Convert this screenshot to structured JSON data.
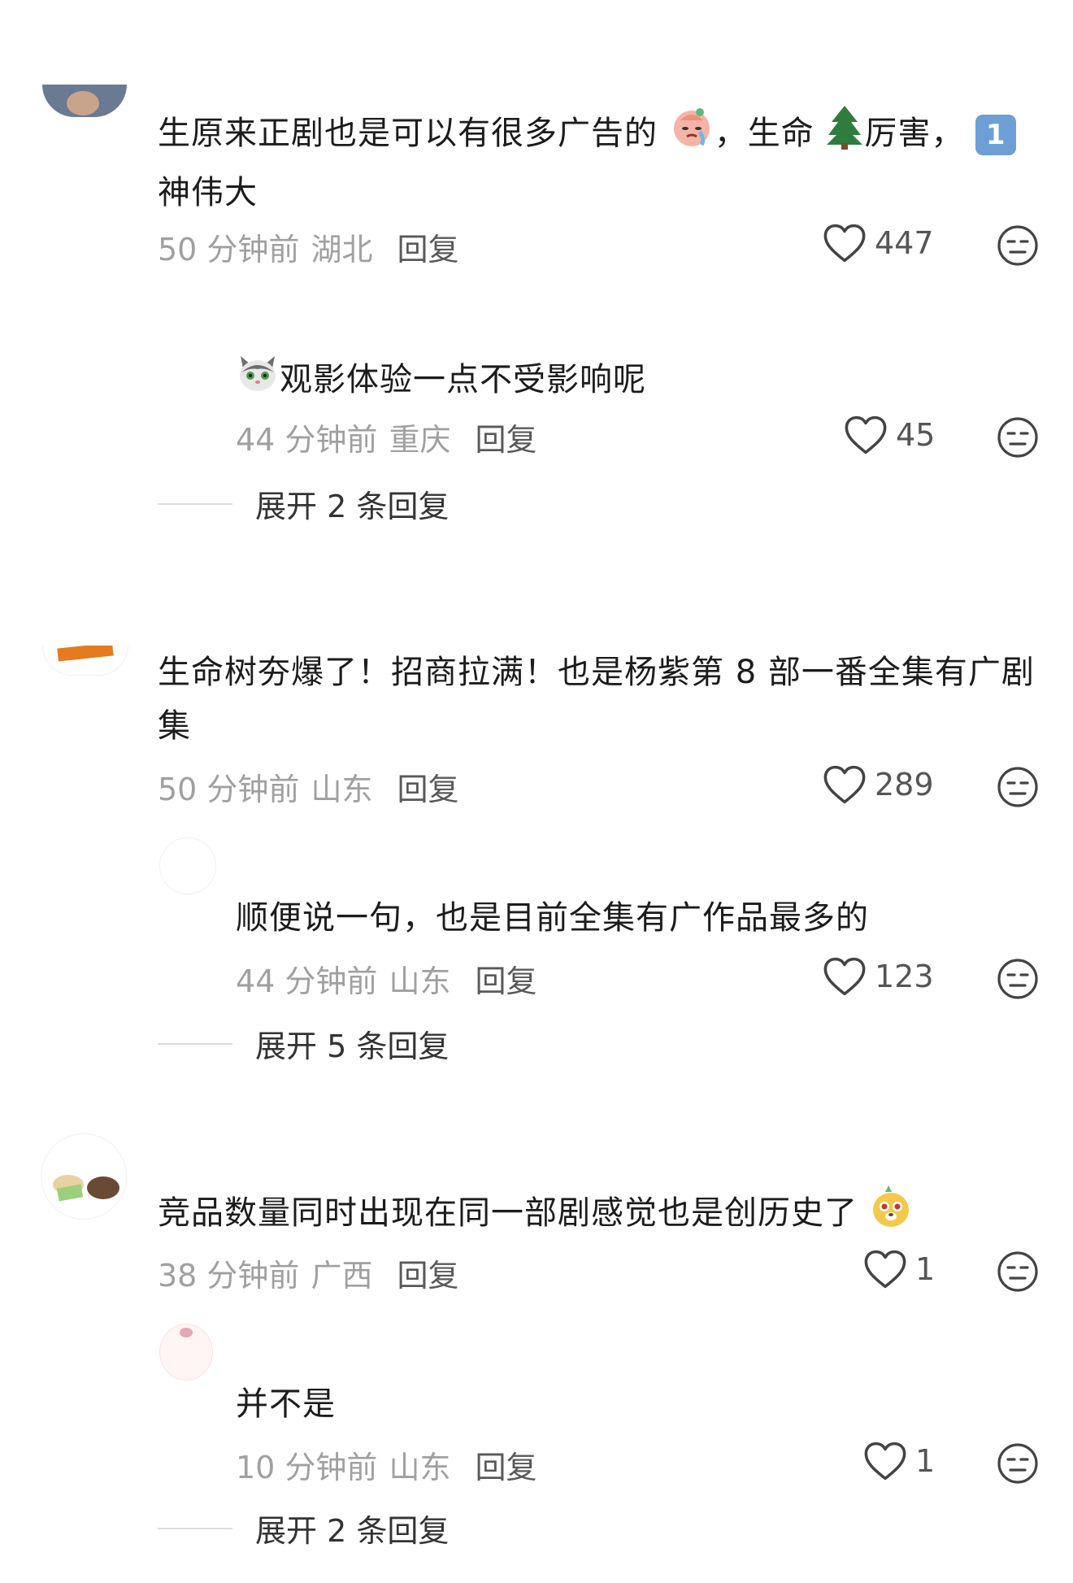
{
  "comments": [
    {
      "text_parts": [
        "生原来正剧也是可以有很多广告的",
        "，生命",
        "厉害，",
        "神伟大"
      ],
      "badge": "1",
      "time": "50 分钟前",
      "location": "湖北",
      "reply_label": "回复",
      "likes": "447",
      "expand_label": null
    },
    {
      "text": "观影体验一点不受影响呢",
      "time": "44 分钟前",
      "location": "重庆",
      "reply_label": "回复",
      "likes": "45",
      "expand_label": "展开 2 条回复"
    },
    {
      "text": "生命树夯爆了！招商拉满！也是杨紫第 8 部一番全集有广剧集",
      "time": "50 分钟前",
      "location": "山东",
      "reply_label": "回复",
      "likes": "289"
    },
    {
      "text": "顺便说一句，也是目前全集有广作品最多的",
      "time": "44 分钟前",
      "location": "山东",
      "reply_label": "回复",
      "likes": "123",
      "expand_label": "展开 5 条回复"
    },
    {
      "text": "竞品数量同时出现在同一部剧感觉也是创历史了",
      "time": "38 分钟前",
      "location": "广西",
      "reply_label": "回复",
      "likes": "1"
    },
    {
      "text": "并不是",
      "time": "10 分钟前",
      "location": "山东",
      "reply_label": "回复",
      "likes": "1",
      "expand_label": "展开 2 条回复"
    }
  ],
  "icons": {
    "like": "heart-outline-icon",
    "dislike": "neutral-face-icon",
    "tree": "evergreen-tree-emoji",
    "crying": "crying-face-emoji",
    "cat": "cat-face-emoji",
    "mole": "mole-face-emoji"
  }
}
